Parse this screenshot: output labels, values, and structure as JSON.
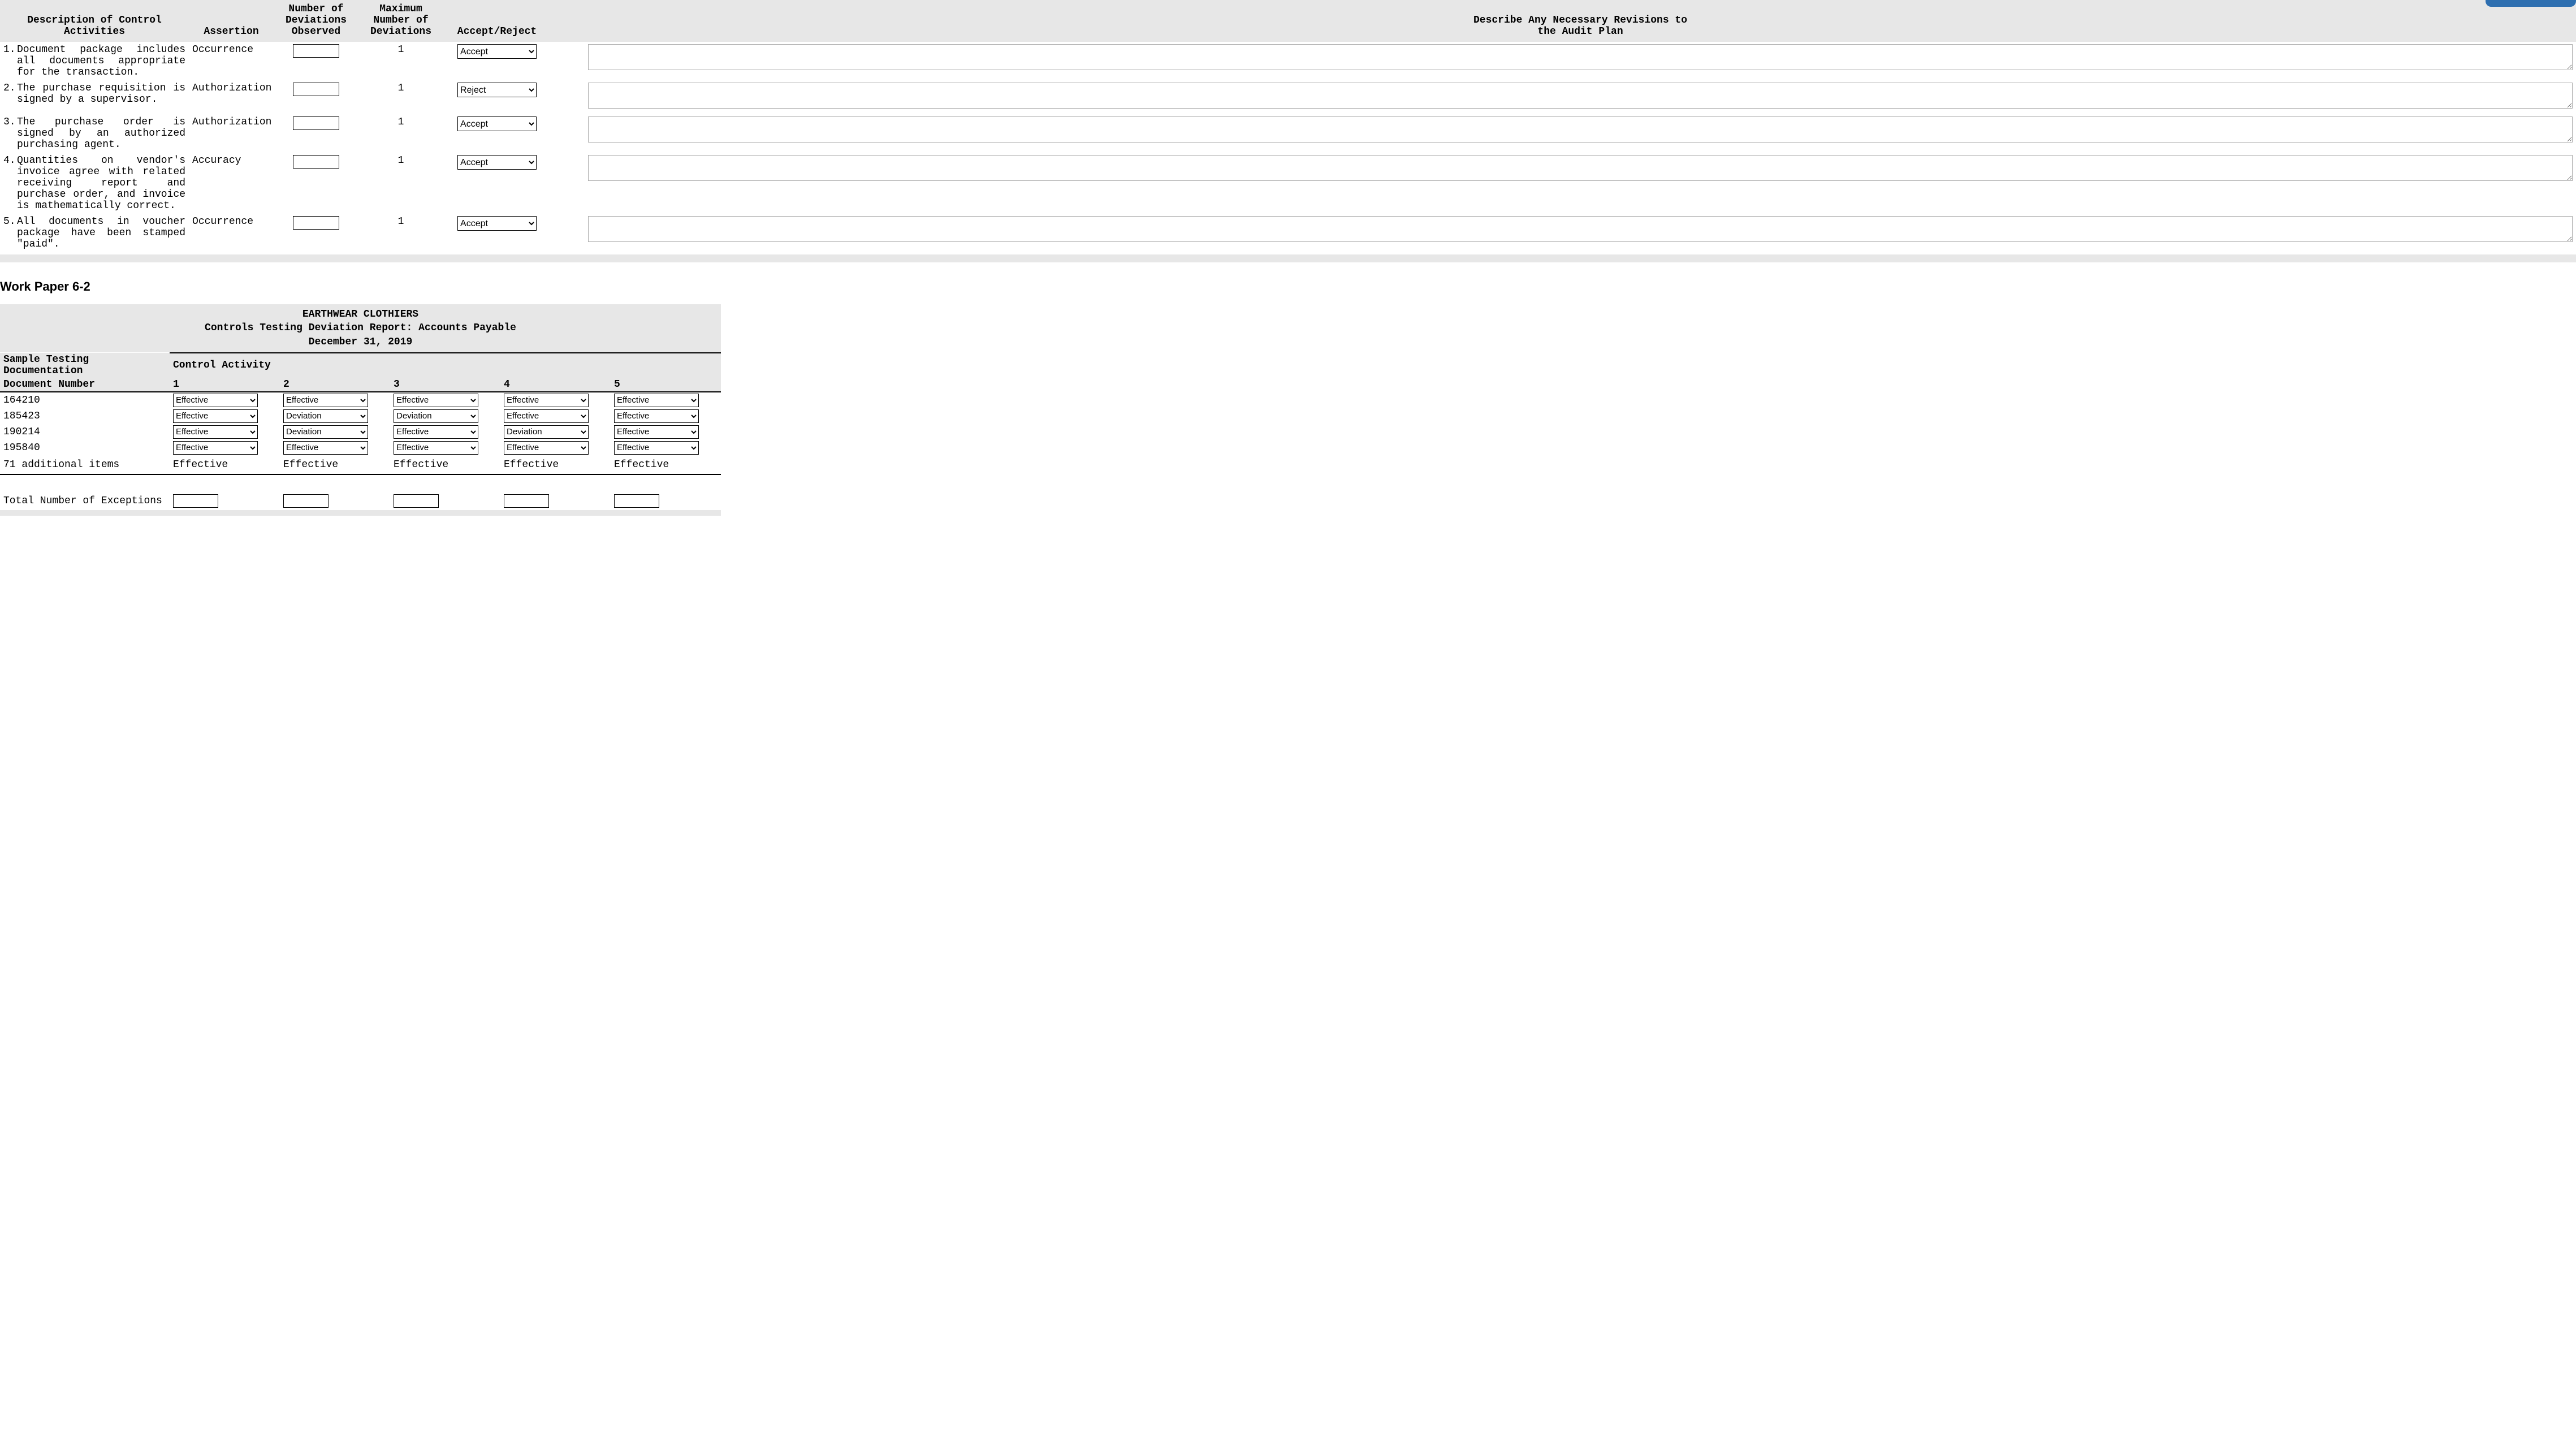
{
  "table1": {
    "headers": {
      "description": "Description of Control\nActivities",
      "assertion": "Assertion",
      "num_dev": "Number of\nDeviations\nObserved",
      "max_dev": "Maximum\nNumber of\nDeviations",
      "accept_reject": "Accept/Reject",
      "revisions": "Describe Any Necessary Revisions to\nthe Audit Plan"
    },
    "accept_reject_options": [
      "Accept",
      "Reject"
    ],
    "rows": [
      {
        "n": "1.",
        "desc": "Document package includes all documents appropriate for the transaction.",
        "assertion": "Occurrence",
        "max": "1",
        "ar": "Accept"
      },
      {
        "n": "2.",
        "desc": "The purchase requisition is signed by a supervisor.",
        "assertion": "Authorization",
        "max": "1",
        "ar": "Reject"
      },
      {
        "n": "3.",
        "desc": "The purchase order is signed by an authorized purchasing agent.",
        "assertion": "Authorization",
        "max": "1",
        "ar": "Accept"
      },
      {
        "n": "4.",
        "desc": "Quantities on vendor's invoice agree with related receiving report and purchase order, and invoice is mathematically correct.",
        "assertion": "Accuracy",
        "max": "1",
        "ar": "Accept"
      },
      {
        "n": "5.",
        "desc": "All documents in voucher package have been stamped \"paid\".",
        "assertion": "Occurrence",
        "max": "1",
        "ar": "Accept"
      }
    ]
  },
  "section_heading": "Work Paper 6-2",
  "table2": {
    "company": "EARTHWEAR CLOTHIERS",
    "report_title": "Controls Testing Deviation Report: Accounts Payable",
    "date": "December 31, 2019",
    "sample_heading": "Sample Testing Documentation",
    "control_activity_label": "Control Activity",
    "doc_num_label": "Document Number",
    "col_labels": [
      "1",
      "2",
      "3",
      "4",
      "5"
    ],
    "eff_options": [
      "Effective",
      "Deviation"
    ],
    "rows": [
      {
        "doc": "164210",
        "vals": [
          "Effective",
          "Effective",
          "Effective",
          "Effective",
          "Effective"
        ]
      },
      {
        "doc": "185423",
        "vals": [
          "Effective",
          "Deviation",
          "Deviation",
          "Effective",
          "Effective"
        ]
      },
      {
        "doc": "190214",
        "vals": [
          "Effective",
          "Deviation",
          "Effective",
          "Deviation",
          "Effective"
        ]
      },
      {
        "doc": "195840",
        "vals": [
          "Effective",
          "Effective",
          "Effective",
          "Effective",
          "Effective"
        ]
      }
    ],
    "additional": {
      "label": "71 additional items",
      "vals": [
        "Effective",
        "Effective",
        "Effective",
        "Effective",
        "Effective"
      ]
    },
    "totals_label": "Total Number of Exceptions"
  }
}
